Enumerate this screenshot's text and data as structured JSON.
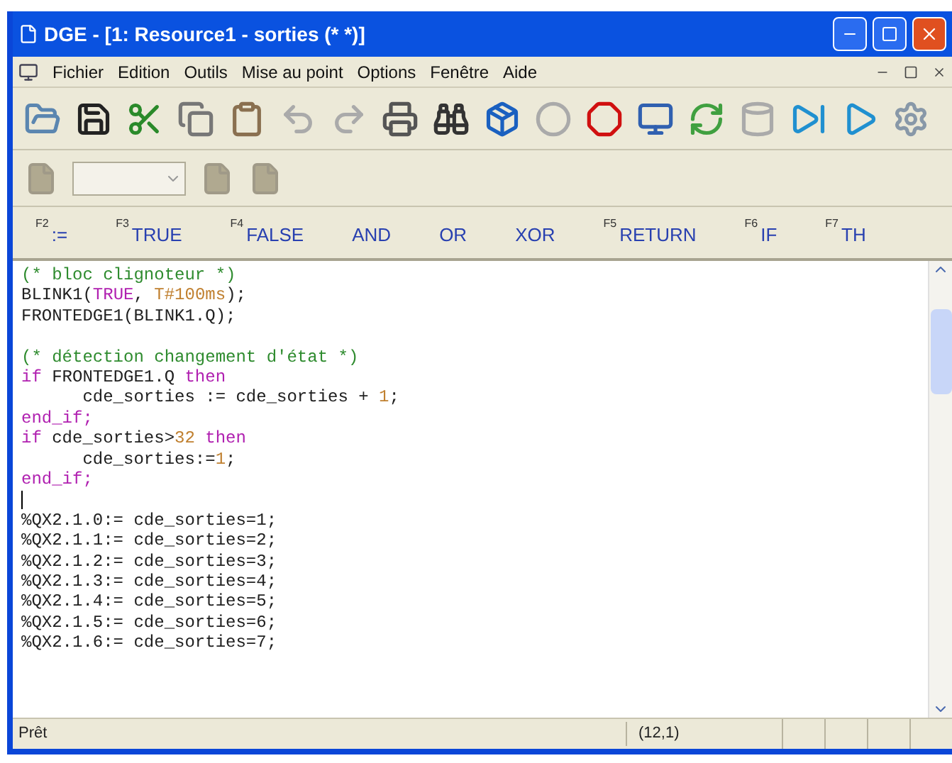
{
  "window": {
    "title": "DGE - [1: Resource1 - sorties (* *)]"
  },
  "menu": [
    "Fichier",
    "Edition",
    "Outils",
    "Mise au point",
    "Options",
    "Fenêtre",
    "Aide"
  ],
  "keyword_bar": [
    {
      "key": "F2",
      "label": ":="
    },
    {
      "key": "F3",
      "label": "TRUE"
    },
    {
      "key": "F4",
      "label": "FALSE"
    },
    {
      "label": "AND"
    },
    {
      "label": "OR"
    },
    {
      "label": "XOR"
    },
    {
      "key": "F5",
      "label": "RETURN"
    },
    {
      "key": "F6",
      "label": "IF"
    },
    {
      "key": "F7",
      "label": "TH"
    }
  ],
  "editor": {
    "lines": [
      {
        "kind": "code",
        "tokens": [
          {
            "kind": "comment",
            "text": "(* bloc clignoteur *)"
          }
        ]
      },
      {
        "kind": "code",
        "tokens": [
          {
            "kind": "plain",
            "text": "BLINK1("
          },
          {
            "kind": "keyword",
            "text": "TRUE"
          },
          {
            "kind": "plain",
            "text": ", "
          },
          {
            "kind": "literal",
            "text": "T#100ms"
          },
          {
            "kind": "plain",
            "text": ");"
          }
        ]
      },
      {
        "kind": "code",
        "tokens": [
          {
            "kind": "plain",
            "text": "FRONTEDGE1(BLINK1.Q);"
          }
        ]
      },
      {
        "kind": "blank"
      },
      {
        "kind": "code",
        "tokens": [
          {
            "kind": "comment",
            "text": "(* détection changement d'état *)"
          }
        ]
      },
      {
        "kind": "code",
        "tokens": [
          {
            "kind": "keyword",
            "text": "if"
          },
          {
            "kind": "plain",
            "text": " FRONTEDGE1.Q "
          },
          {
            "kind": "keyword",
            "text": "then"
          }
        ]
      },
      {
        "kind": "code",
        "tokens": [
          {
            "kind": "plain",
            "text": "      cde_sorties := cde_sorties + "
          },
          {
            "kind": "literal",
            "text": "1"
          },
          {
            "kind": "plain",
            "text": ";"
          }
        ]
      },
      {
        "kind": "code",
        "tokens": [
          {
            "kind": "keyword",
            "text": "end_if;"
          }
        ]
      },
      {
        "kind": "code",
        "tokens": [
          {
            "kind": "keyword",
            "text": "if"
          },
          {
            "kind": "plain",
            "text": " cde_sorties>"
          },
          {
            "kind": "literal",
            "text": "32"
          },
          {
            "kind": "keyword",
            "text": " then"
          }
        ]
      },
      {
        "kind": "code",
        "tokens": [
          {
            "kind": "plain",
            "text": "      cde_sorties:="
          },
          {
            "kind": "literal",
            "text": "1"
          },
          {
            "kind": "plain",
            "text": ";"
          }
        ]
      },
      {
        "kind": "code",
        "tokens": [
          {
            "kind": "keyword",
            "text": "end_if;"
          }
        ]
      },
      {
        "kind": "cursor"
      },
      {
        "kind": "code",
        "tokens": [
          {
            "kind": "plain",
            "text": "%QX2.1.0:= cde_sorties=1;"
          }
        ]
      },
      {
        "kind": "code",
        "tokens": [
          {
            "kind": "plain",
            "text": "%QX2.1.1:= cde_sorties=2;"
          }
        ]
      },
      {
        "kind": "code",
        "tokens": [
          {
            "kind": "plain",
            "text": "%QX2.1.2:= cde_sorties=3;"
          }
        ]
      },
      {
        "kind": "code",
        "tokens": [
          {
            "kind": "plain",
            "text": "%QX2.1.3:= cde_sorties=4;"
          }
        ]
      },
      {
        "kind": "code",
        "tokens": [
          {
            "kind": "plain",
            "text": "%QX2.1.4:= cde_sorties=5;"
          }
        ]
      },
      {
        "kind": "code",
        "tokens": [
          {
            "kind": "plain",
            "text": "%QX2.1.5:= cde_sorties=6;"
          }
        ]
      },
      {
        "kind": "code",
        "tokens": [
          {
            "kind": "plain",
            "text": "%QX2.1.6:= cde_sorties=7;"
          }
        ]
      }
    ]
  },
  "status_bar": {
    "message": "Prêt",
    "position": "(12,1)"
  }
}
